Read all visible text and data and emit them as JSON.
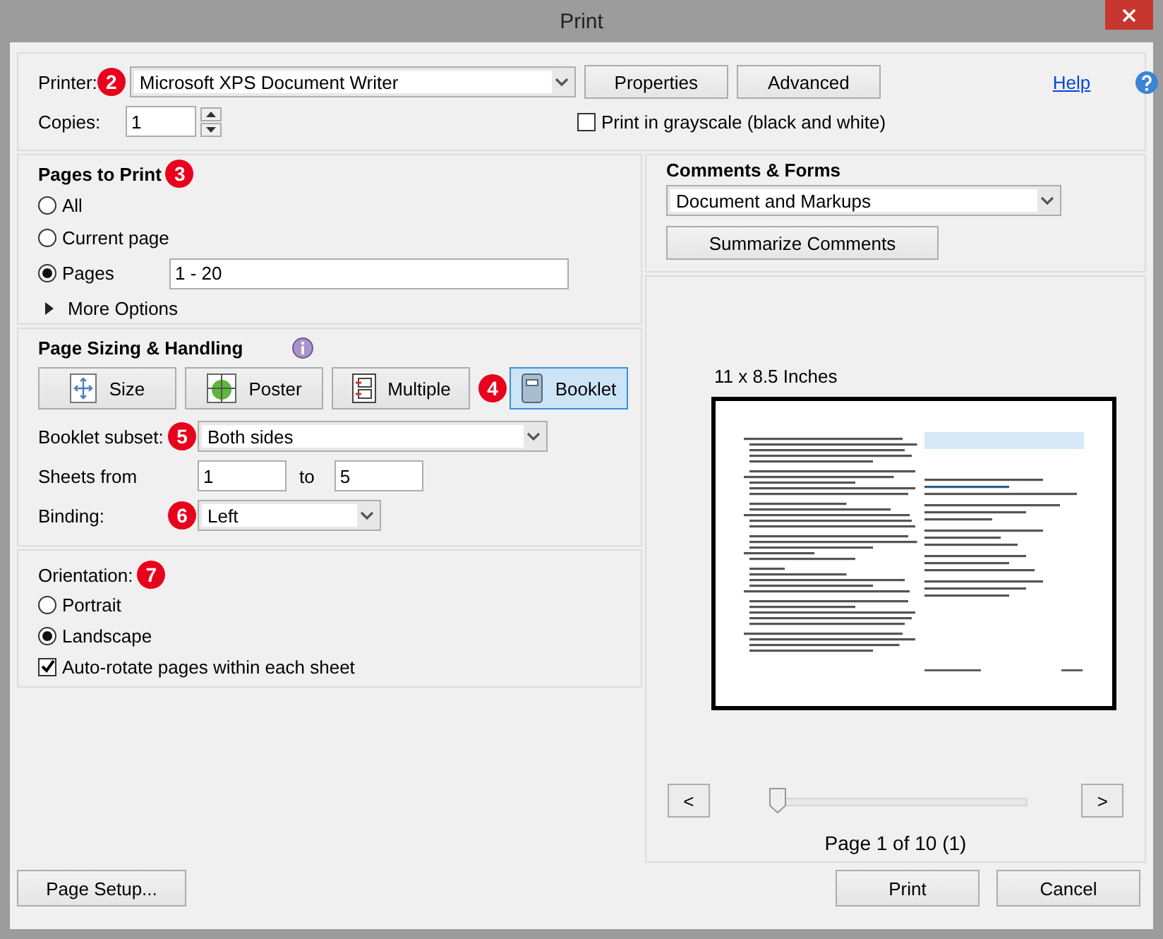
{
  "window": {
    "title": "Print"
  },
  "printer": {
    "label": "Printer:",
    "badge": "2",
    "value": "Microsoft XPS Document Writer",
    "buttons": [
      "Properties",
      "Advanced"
    ],
    "help": "Help"
  },
  "copies": {
    "label": "Copies:",
    "value": "1"
  },
  "grayscale": {
    "label": "Print in grayscale (black and white)",
    "checked": false
  },
  "pages_to_print": {
    "title": "Pages to Print",
    "badge": "3",
    "options": [
      {
        "label": "All",
        "selected": false
      },
      {
        "label": "Current page",
        "selected": false
      },
      {
        "label": "Pages",
        "selected": true,
        "value": "1 - 20"
      }
    ],
    "more_options": "More Options"
  },
  "page_sizing": {
    "title": "Page Sizing & Handling",
    "modes": [
      {
        "label": "Size",
        "kind": "size",
        "selected": false
      },
      {
        "label": "Poster",
        "kind": "poster",
        "selected": false
      },
      {
        "label": "Multiple",
        "kind": "multiple",
        "selected": false
      },
      {
        "label": "Booklet",
        "kind": "booklet",
        "selected": true,
        "badge": "4"
      }
    ],
    "fields": [
      {
        "label": "Booklet subset:",
        "badge": "5",
        "kind": "select",
        "value": "Both sides"
      },
      {
        "label": "Sheets from",
        "kind": "range",
        "from": "1",
        "joiner": "to",
        "to": "5"
      },
      {
        "label": "Binding:",
        "badge": "6",
        "kind": "select",
        "value": "Left"
      }
    ]
  },
  "orientation": {
    "title": "Orientation:",
    "badge": "7",
    "options": [
      {
        "label": "Portrait",
        "selected": false
      },
      {
        "label": "Landscape",
        "selected": true
      }
    ],
    "auto_rotate": {
      "label": "Auto-rotate pages within each sheet",
      "checked": true
    }
  },
  "comments_forms": {
    "title": "Comments & Forms",
    "value": "Document and Markups",
    "button": "Summarize Comments"
  },
  "preview": {
    "size_label": "11 x 8.5 Inches",
    "prev": "<",
    "next": ">",
    "level": 0,
    "page_label": "Page 1 of 10 (1)"
  },
  "footer": {
    "page_setup": "Page Setup...",
    "print": "Print",
    "cancel": "Cancel"
  }
}
